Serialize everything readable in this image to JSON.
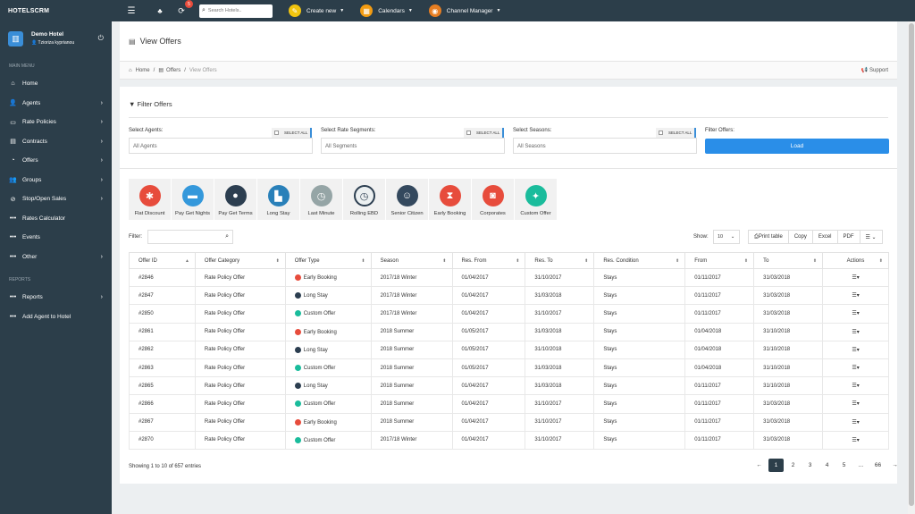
{
  "app": {
    "brand": "HOTELSCRM",
    "notif_count": "5",
    "search_placeholder": "Search Hotels.."
  },
  "topmenu": [
    {
      "label": "Create new",
      "color": "#f1c40f",
      "icon": "✎"
    },
    {
      "label": "Calendars",
      "color": "#f39c12",
      "icon": "▦"
    },
    {
      "label": "Channel Manager",
      "color": "#e67e22",
      "icon": "◉"
    }
  ],
  "profile": {
    "name": "Demo Hotel",
    "user": "Tzioriza kyprianou"
  },
  "sidebar": {
    "main_menu": "MAIN MENU",
    "items": [
      {
        "label": "Home",
        "icon": "⌂",
        "chev": ""
      },
      {
        "label": "Agents",
        "icon": "👤",
        "chev": "›"
      },
      {
        "label": "Rate Policies",
        "icon": "▭",
        "chev": "›"
      },
      {
        "label": "Contracts",
        "icon": "▤",
        "chev": "›"
      },
      {
        "label": "Offers",
        "icon": "◔",
        "chev": "›"
      },
      {
        "label": "Groups",
        "icon": "👥",
        "chev": "›"
      },
      {
        "label": "Stop/Open Sales",
        "icon": "⊘",
        "chev": "›"
      },
      {
        "label": "Rates Calculator",
        "icon": "•••",
        "chev": ""
      },
      {
        "label": "Events",
        "icon": "•••",
        "chev": ""
      },
      {
        "label": "Other",
        "icon": "•••",
        "chev": "›"
      }
    ],
    "reports_label": "REPORTS",
    "reports": [
      {
        "label": "Reports",
        "icon": "•••",
        "chev": "›"
      },
      {
        "label": "Add Agent to Hotel",
        "icon": "•••",
        "chev": ""
      }
    ]
  },
  "page": {
    "title": "View Offers",
    "breadcrumb": [
      "Home",
      "Offers",
      "View Offers"
    ],
    "support": "Support"
  },
  "filters": {
    "title": "Filter Offers",
    "agents_label": "Select Agents:",
    "agents_value": "All Agents",
    "segments_label": "Select Rate Segments:",
    "segments_value": "All Segments",
    "seasons_label": "Select Seasons:",
    "seasons_value": "All Seasons",
    "select_all": "SELECT ALL",
    "offers_label": "Filter Offers:",
    "load": "Load"
  },
  "offer_types": [
    {
      "label": "Flat Discount",
      "color": "#e74c3c",
      "icon": "✱"
    },
    {
      "label": "Pay Get Nights",
      "color": "#3498db",
      "icon": "▬"
    },
    {
      "label": "Pay Get Terms",
      "color": "#2c3e50",
      "icon": "●"
    },
    {
      "label": "Long Stay",
      "color": "#2980b9",
      "icon": "▙"
    },
    {
      "label": "Last Minute",
      "color": "#95a5a6",
      "icon": "◷"
    },
    {
      "label": "Rolling EBD",
      "color": "#ecf0f1",
      "icon": "◷"
    },
    {
      "label": "Senior Citizen",
      "color": "#34495e",
      "icon": "☺"
    },
    {
      "label": "Early Booking",
      "color": "#e74c3c",
      "icon": "⧗"
    },
    {
      "label": "Corporates",
      "color": "#e74c3c",
      "icon": "◙"
    },
    {
      "label": "Custom Offer",
      "color": "#1abc9c",
      "icon": "✦"
    }
  ],
  "table": {
    "filter_label": "Filter:",
    "show_label": "Show:",
    "show_value": "10",
    "buttons": [
      "Print table",
      "Copy",
      "Excel",
      "PDF"
    ],
    "columns": [
      "Offer ID",
      "Offer Category",
      "Offer Type",
      "Season",
      "Res. From",
      "Res. To",
      "Res. Condition",
      "From",
      "To",
      "Actions"
    ],
    "rows": [
      [
        "#2846",
        "Rate Policy Offer",
        "Early Booking",
        "2017/18 Winter",
        "01/04/2017",
        "31/10/2017",
        "Stays",
        "01/11/2017",
        "31/03/2018"
      ],
      [
        "#2847",
        "Rate Policy Offer",
        "Long Stay",
        "2017/18 Winter",
        "01/04/2017",
        "31/03/2018",
        "Stays",
        "01/11/2017",
        "31/03/2018"
      ],
      [
        "#2850",
        "Rate Policy Offer",
        "Custom Offer",
        "2017/18 Winter",
        "01/04/2017",
        "31/10/2017",
        "Stays",
        "01/11/2017",
        "31/03/2018"
      ],
      [
        "#2861",
        "Rate Policy Offer",
        "Early Booking",
        "2018 Summer",
        "01/05/2017",
        "31/03/2018",
        "Stays",
        "01/04/2018",
        "31/10/2018"
      ],
      [
        "#2862",
        "Rate Policy Offer",
        "Long Stay",
        "2018 Summer",
        "01/05/2017",
        "31/10/2018",
        "Stays",
        "01/04/2018",
        "31/10/2018"
      ],
      [
        "#2863",
        "Rate Policy Offer",
        "Custom Offer",
        "2018 Summer",
        "01/05/2017",
        "31/03/2018",
        "Stays",
        "01/04/2018",
        "31/10/2018"
      ],
      [
        "#2865",
        "Rate Policy Offer",
        "Long Stay",
        "2018 Summer",
        "01/04/2017",
        "31/03/2018",
        "Stays",
        "01/11/2017",
        "31/10/2018"
      ],
      [
        "#2866",
        "Rate Policy Offer",
        "Custom Offer",
        "2018 Summer",
        "01/04/2017",
        "31/10/2017",
        "Stays",
        "01/11/2017",
        "31/03/2018"
      ],
      [
        "#2867",
        "Rate Policy Offer",
        "Early Booking",
        "2018 Summer",
        "01/04/2017",
        "31/10/2017",
        "Stays",
        "01/11/2017",
        "31/03/2018"
      ],
      [
        "#2870",
        "Rate Policy Offer",
        "Custom Offer",
        "2017/18 Winter",
        "01/04/2017",
        "31/10/2017",
        "Stays",
        "01/11/2017",
        "31/03/2018"
      ]
    ],
    "type_colors": {
      "Early Booking": "#e74c3c",
      "Long Stay": "#2c3e50",
      "Custom Offer": "#1abc9c"
    },
    "info": "Showing 1 to 10 of 657 entries",
    "pages": [
      "←",
      "1",
      "2",
      "3",
      "4",
      "5",
      "...",
      "66",
      "→"
    ],
    "current_page": "1"
  }
}
